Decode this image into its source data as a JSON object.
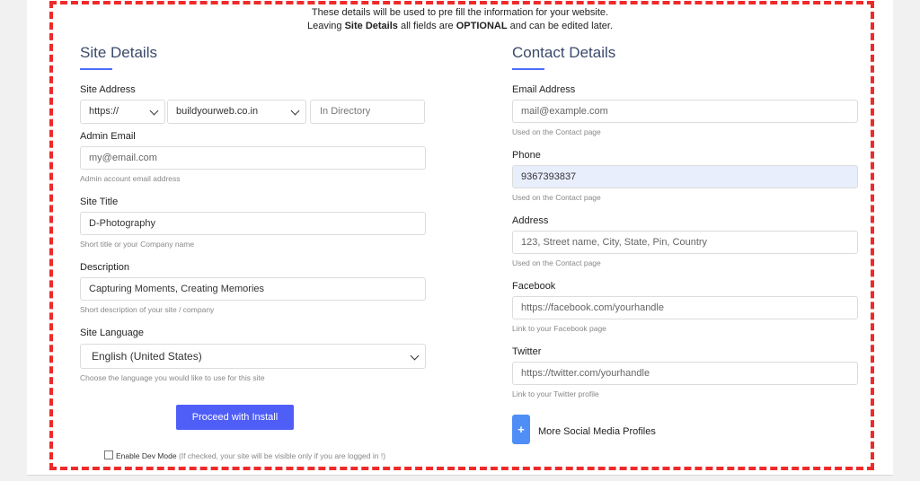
{
  "notice": {
    "line1": "These details will be used to pre fill the information for your website.",
    "line2_prefix": "Leaving ",
    "line2_bold1": "Site Details",
    "line2_mid": " all fields are ",
    "line2_bold2": "OPTIONAL",
    "line2_suffix": " and can be edited later."
  },
  "site": {
    "title": "Site Details",
    "address_label": "Site Address",
    "protocol": "https://",
    "domain": "buildyourweb.co.in",
    "directory_placeholder": "In Directory",
    "admin_email_label": "Admin Email",
    "admin_email_placeholder": "my@email.com",
    "admin_email_help": "Admin account email address",
    "site_title_label": "Site Title",
    "site_title_value": "D-Photography",
    "site_title_help": "Short title or your Company name",
    "description_label": "Description",
    "description_value": "Capturing Moments, Creating Memories",
    "description_help": "Short description of your site / company",
    "language_label": "Site Language",
    "language_value": "English (United States)",
    "language_help": "Choose the language you would like to use for this site",
    "proceed_label": "Proceed with Install",
    "devmode_label": "Enable Dev Mode",
    "devmode_note": "(If checked, your site will be visible only if you are logged in !)"
  },
  "contact": {
    "title": "Contact Details",
    "email_label": "Email Address",
    "email_placeholder": "mail@example.com",
    "email_help": "Used on the Contact page",
    "phone_label": "Phone",
    "phone_value": "9367393837",
    "phone_help": "Used on the Contact page",
    "address_label": "Address",
    "address_placeholder": "123, Street name, City, State, Pin, Country",
    "address_help": "Used on the Contact page",
    "facebook_label": "Facebook",
    "facebook_placeholder": "https://facebook.com/yourhandle",
    "facebook_help": "Link to your Facebook page",
    "twitter_label": "Twitter",
    "twitter_placeholder": "https://twitter.com/yourhandle",
    "twitter_help": "Link to your Twitter profile",
    "more_social_label": "More Social Media Profiles",
    "plus_symbol": "+"
  },
  "icons": {
    "plus": "plus-icon",
    "chevron": "chevron-down-icon",
    "checkbox": "checkbox-icon"
  },
  "colors": {
    "highlight_border": "#ee2a2a",
    "primary_button": "#4f5ef7",
    "accent_underline": "#4f6ef7",
    "title_color": "#3a4a6b",
    "autofill_bg": "#e8eefc"
  }
}
